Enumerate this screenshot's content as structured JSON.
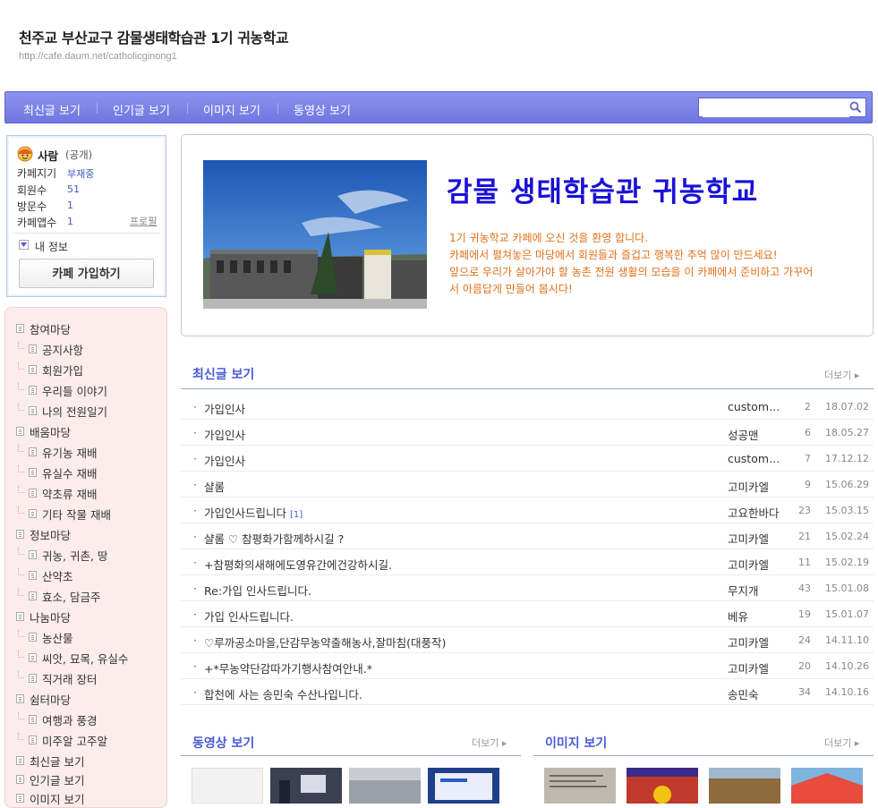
{
  "header": {
    "title": "천주교 부산교구 감물생태학습관 1기 귀농학교",
    "url": "http://cafe.daum.net/catholicginong1"
  },
  "nav": {
    "items": [
      "최신글 보기",
      "인기글 보기",
      "이미지 보기",
      "동영상 보기"
    ],
    "search_placeholder": ""
  },
  "profile": {
    "name": "사람",
    "visibility": "(공개)",
    "rows": [
      {
        "label": "카페지기",
        "value": "부재중"
      },
      {
        "label": "회원수",
        "value": "51"
      },
      {
        "label": "방문수",
        "value": "1"
      },
      {
        "label": "카페앱수",
        "value": "1"
      }
    ],
    "profile_link": "프로필",
    "my_info": "내 정보",
    "join_button": "카페 가입하기"
  },
  "menu": {
    "items": [
      {
        "label": "참여마당",
        "level": 0
      },
      {
        "label": "공지사항",
        "level": 1
      },
      {
        "label": "회원가입",
        "level": 1
      },
      {
        "label": "우리들 이야기",
        "level": 1
      },
      {
        "label": "나의 전원일기",
        "level": 1
      },
      {
        "label": "배움마당",
        "level": 0
      },
      {
        "label": "유기농 재배",
        "level": 1
      },
      {
        "label": "유실수 재배",
        "level": 1
      },
      {
        "label": "약초류 재배",
        "level": 1
      },
      {
        "label": "기타 작물 재배",
        "level": 1
      },
      {
        "label": "정보마당",
        "level": 0
      },
      {
        "label": "귀농, 귀촌, 땅",
        "level": 1
      },
      {
        "label": "산약초",
        "level": 1
      },
      {
        "label": "효소, 담금주",
        "level": 1
      },
      {
        "label": "나눔마당",
        "level": 0
      },
      {
        "label": "농산물",
        "level": 1
      },
      {
        "label": "씨앗, 묘목, 유실수",
        "level": 1
      },
      {
        "label": "직거래 장터",
        "level": 1
      },
      {
        "label": "쉼터마당",
        "level": 0
      },
      {
        "label": "여행과 풍경",
        "level": 1
      },
      {
        "label": "미주알 고주알",
        "level": 1
      },
      {
        "label": "최신글 보기",
        "level": 0
      },
      {
        "label": "인기글 보기",
        "level": 0
      },
      {
        "label": "이미지 보기",
        "level": 0
      }
    ]
  },
  "banner": {
    "title": "감물 생태학습관 귀농학교",
    "welcome_lines": [
      "1기 귀농학교 카페에 오신 것을 환영 합니다.",
      "카페에서 펼쳐놓은 마당에서 회원들과 즐겁고 행복한 추억 많이 만드세요!",
      "앞으로 우리가 살아가야 할 농촌 전원 생활의 모습을 이 카페에서 준비하고 가꾸어",
      "서 아름답게 만들어 봅시다!"
    ]
  },
  "recent": {
    "title": "최신글 보기",
    "more": "더보기 ▸",
    "posts": [
      {
        "title": "가입인사",
        "comments": "",
        "author": "custom…",
        "views": "2",
        "date": "18.07.02"
      },
      {
        "title": "가입인사",
        "comments": "",
        "author": "성공맨",
        "views": "6",
        "date": "18.05.27"
      },
      {
        "title": "가입인사",
        "comments": "",
        "author": "custom…",
        "views": "7",
        "date": "17.12.12"
      },
      {
        "title": "샬롬",
        "comments": "",
        "author": "고미카엘",
        "views": "9",
        "date": "15.06.29"
      },
      {
        "title": "가입인사드립니다",
        "comments": "[1]",
        "author": "고요한바다",
        "views": "23",
        "date": "15.03.15"
      },
      {
        "title": "샬롬 ♡ 참평화가함께하시길 ?",
        "comments": "",
        "author": "고미카엘",
        "views": "21",
        "date": "15.02.24"
      },
      {
        "title": "+참평화의새해에도영유간에건강하시길.",
        "comments": "",
        "author": "고미카엘",
        "views": "11",
        "date": "15.02.19"
      },
      {
        "title": "Re:가입 인사드립니다.",
        "comments": "",
        "author": "무지개",
        "views": "43",
        "date": "15.01.08"
      },
      {
        "title": "가입 인사드립니다.",
        "comments": "",
        "author": "베유",
        "views": "19",
        "date": "15.01.07"
      },
      {
        "title": "♡루까공소마을,단감무농약출해농사,잘마침(대풍작)",
        "comments": "",
        "author": "고미카엘",
        "views": "24",
        "date": "14.11.10"
      },
      {
        "title": "+*무농약단감따가기행사참여안내.*",
        "comments": "",
        "author": "고미카엘",
        "views": "20",
        "date": "14.10.26"
      },
      {
        "title": "합천에 사는 송민숙 수산나입니다.",
        "comments": "",
        "author": "송민숙",
        "views": "34",
        "date": "14.10.16"
      }
    ]
  },
  "video_section": {
    "title": "동영상 보기",
    "more": "더보기 ▸"
  },
  "image_section": {
    "title": "이미지 보기",
    "more": "더보기 ▸"
  },
  "colors": {
    "nav": "#7a82e6",
    "accent": "#4a5bd3",
    "banner_title": "#1a10d6",
    "welcome": "#e0711a"
  }
}
